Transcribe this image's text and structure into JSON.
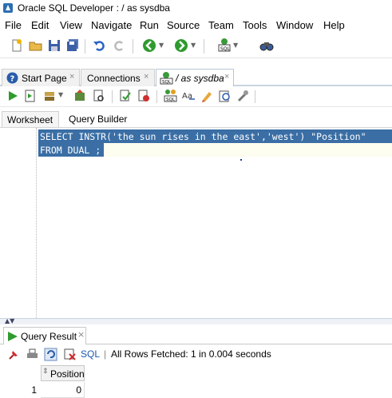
{
  "window": {
    "title": "Oracle SQL Developer : / as sysdba"
  },
  "menu": [
    "File",
    "Edit",
    "View",
    "Navigate",
    "Run",
    "Source",
    "Team",
    "Tools",
    "Window",
    "Help"
  ],
  "toolbar_icons": [
    "new-file-icon",
    "open-folder-icon",
    "save-icon",
    "save-all-icon",
    "undo-icon",
    "redo-icon",
    "back-icon",
    "forward-icon",
    "sql-worksheet-icon",
    "find-db-object-icon"
  ],
  "tabs": [
    {
      "label": "Start Page",
      "icon": "help-icon"
    },
    {
      "label": "Connections",
      "icon": ""
    },
    {
      "label": "/ as sysdba",
      "icon": "sql-icon"
    }
  ],
  "worksheet_toolbar_icons": [
    "run-statement-icon",
    "run-script-icon",
    "commit-icon",
    "rollback-icon",
    "explain-plan-icon",
    "autotrace-icon",
    "clear-icon",
    "sql-tuning-icon",
    "format-icon",
    "clear-editor-icon",
    "history-icon",
    "tools-icon"
  ],
  "subtabs": [
    "Worksheet",
    "Query Builder"
  ],
  "editor": {
    "lines": [
      "SELECT INSTR('the sun rises in the east','west') \"Position\"",
      "FROM DUAL ;"
    ]
  },
  "result": {
    "tab_label": "Query Result",
    "sql_label": "SQL",
    "status": "All Rows Fetched: 1 in 0.004 seconds",
    "columns": [
      "Position"
    ],
    "rows": [
      {
        "num": "1",
        "values": [
          "0"
        ]
      }
    ]
  },
  "colors": {
    "selection": "#3a6ea5",
    "selection_tail": "#fdfdf0",
    "accent_green": "#2e9b2e"
  }
}
